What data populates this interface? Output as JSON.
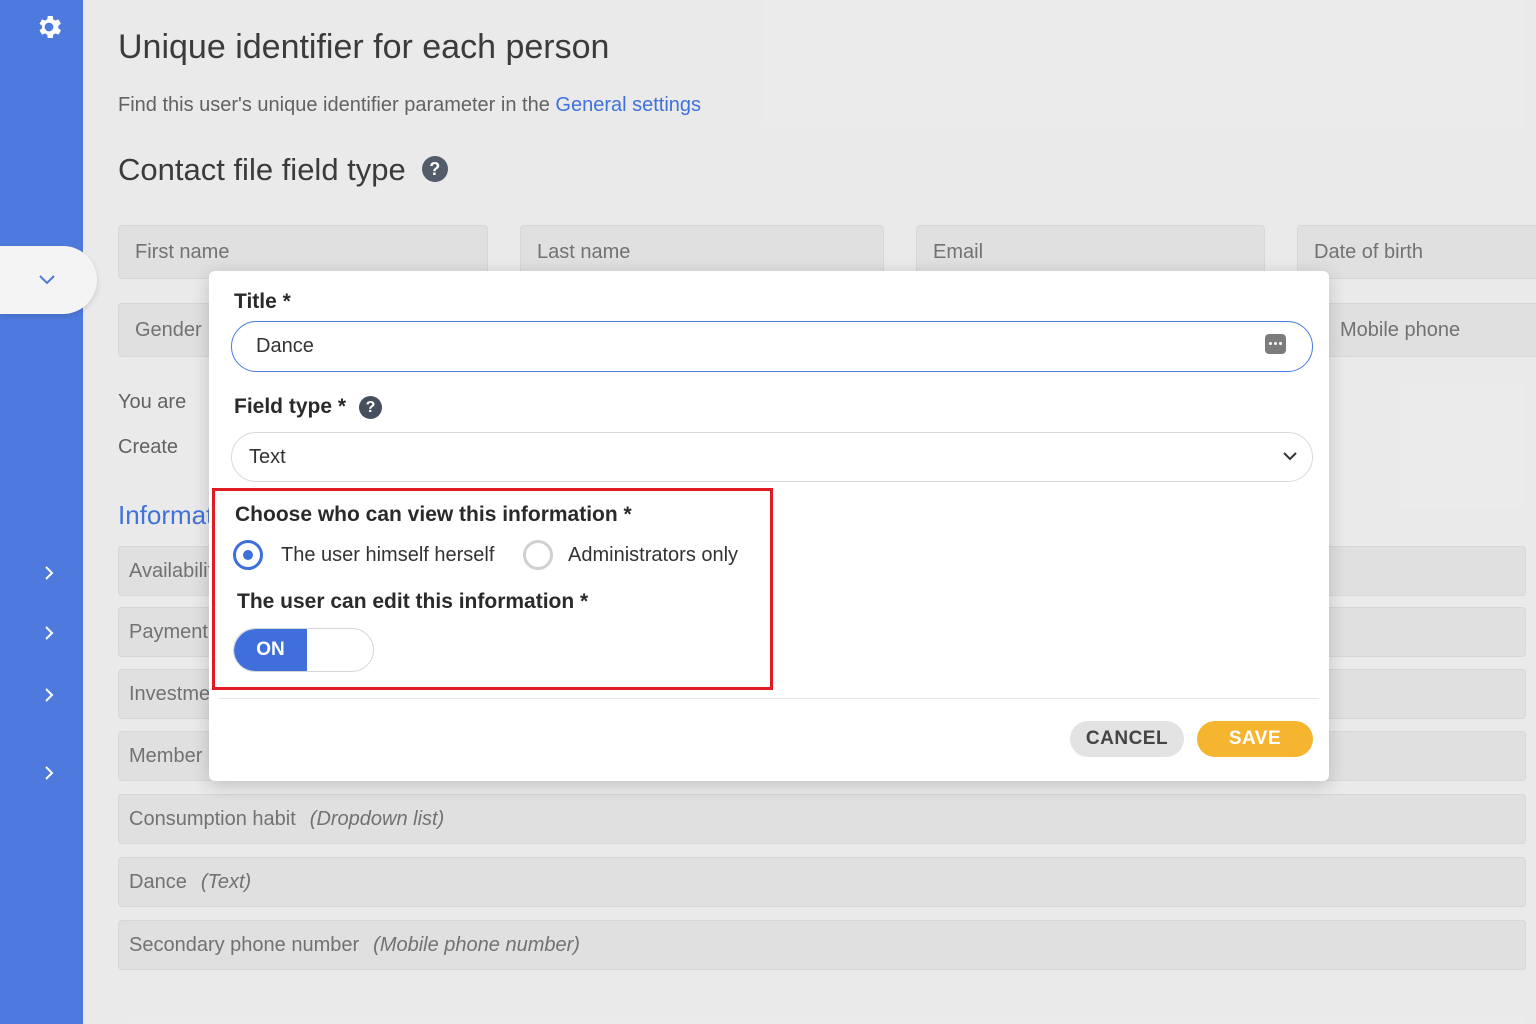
{
  "sidebar": {
    "icons": [
      "gear-icon",
      "chevron-down-icon",
      "chevron-right-icon",
      "chevron-right-icon",
      "chevron-right-icon",
      "chevron-right-icon"
    ]
  },
  "page": {
    "title": "Unique identifier for each person",
    "intro_text": "Find this user's unique identifier parameter in the ",
    "intro_link": "General settings",
    "section_title": "Contact file field type"
  },
  "fields": {
    "first_name": "First name",
    "last_name": "Last name",
    "email": "Email",
    "date_of_birth": "Date of birth",
    "gender": "Gender",
    "mobile_phone": "Mobile phone"
  },
  "background": {
    "you_are": "You are",
    "create": "Create",
    "info_heading": "Informat"
  },
  "info_rows": [
    {
      "name": "Availabilit",
      "type": ""
    },
    {
      "name": "Payment r",
      "type": ""
    },
    {
      "name": "Investmer",
      "type": ""
    },
    {
      "name": "Member r",
      "type": ""
    },
    {
      "name": "Consumption habit",
      "type": "(Dropdown list)"
    },
    {
      "name": "Dance",
      "type": "(Text)"
    },
    {
      "name": "Secondary phone number",
      "type": "(Mobile phone number)"
    }
  ],
  "modal": {
    "title_label": "Title *",
    "title_value": "Dance",
    "field_type_label": "Field type *",
    "field_type_value": "Text",
    "view_label": "Choose who can view this information *",
    "view_options": [
      "The user himself herself",
      "Administrators only"
    ],
    "view_selected": "The user himself herself",
    "edit_label": "The user can edit this information *",
    "toggle_label": "ON",
    "cancel_label": "CANCEL",
    "save_label": "SAVE"
  },
  "colors": {
    "sidebar": "#3f6fdb",
    "accent": "#2f66d8",
    "save": "#f5b52e",
    "highlight": "#e11b23"
  }
}
